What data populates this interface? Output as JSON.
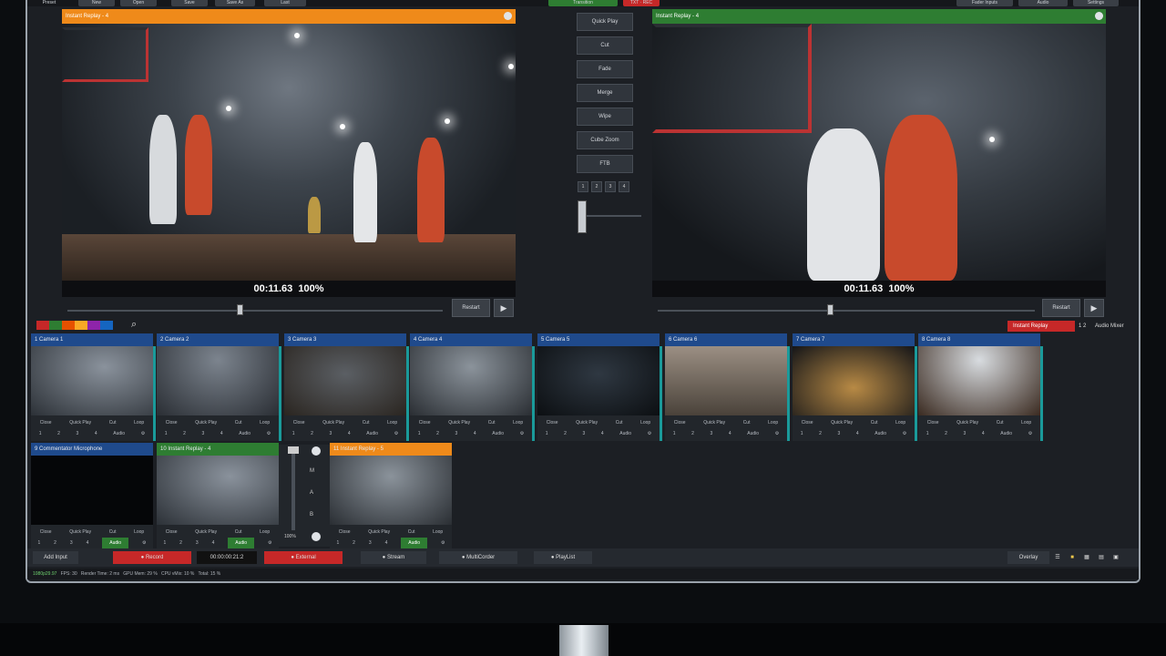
{
  "top_toolbar": {
    "items": [
      "Preset",
      "New",
      "Open",
      "Save",
      "Save As",
      "Last"
    ],
    "transition_dropdown": "Transition",
    "replay_status": "TXT · REC",
    "right_items": [
      "Fader Inputs",
      "Audio",
      "Settings"
    ]
  },
  "preview": {
    "title": "Instant Replay - 4",
    "timecode": "00:11.63",
    "zoom": "100%",
    "restart": "Restart"
  },
  "output": {
    "title": "Instant Replay - 4",
    "timecode": "00:11.63",
    "zoom": "100%",
    "restart": "Restart"
  },
  "transitions": {
    "buttons": [
      "Quick Play",
      "Cut",
      "Fade",
      "Merge",
      "Wipe",
      "Cube Zoom",
      "FTB"
    ],
    "numbers": [
      "1",
      "2",
      "3",
      "4"
    ]
  },
  "color_swatches": [
    "#c62828",
    "#2e7d32",
    "#e65100",
    "#f9a825",
    "#8e24aa",
    "#1565c0"
  ],
  "audio_mixer": {
    "instant_replay": "Instant Replay",
    "count": "1 2",
    "label": "Audio Mixer"
  },
  "tile_controls": {
    "row1": [
      "Close",
      "Quick Play",
      "Cut",
      "Loop"
    ],
    "row2": [
      "1",
      "2",
      "3",
      "4",
      "Audio"
    ]
  },
  "inputs": [
    {
      "label": "1   Camera 1",
      "color": "#1f4a8c"
    },
    {
      "label": "2   Camera 2",
      "color": "#1f4a8c"
    },
    {
      "label": "3   Camera 3",
      "color": "#1f4a8c"
    },
    {
      "label": "4   Camera 4",
      "color": "#1f4a8c"
    },
    {
      "label": "5   Camera 5",
      "color": "#1f4a8c"
    },
    {
      "label": "6   Camera 6",
      "color": "#1f4a8c"
    },
    {
      "label": "7   Camera 7",
      "color": "#1f4a8c"
    },
    {
      "label": "8   Camera 8",
      "color": "#1f4a8c"
    },
    {
      "label": "9   Commentator Microphone",
      "color": "#1f4a8c"
    },
    {
      "label": "10   Instant Replay - 4",
      "color": "#2e7d32"
    },
    {
      "label": "11   Instant Replay - 5",
      "color": "#ef8a1a"
    }
  ],
  "master": {
    "labels": [
      "100%",
      "M",
      "A",
      "B"
    ]
  },
  "bottom_bar": {
    "add_input": "Add Input",
    "record": "Record",
    "rec_time": "00:00:00:21:2",
    "external": "External",
    "stream": "Stream",
    "multicorder": "MultiCorder",
    "playlist": "PlayList",
    "overlay": "Overlay"
  },
  "status": {
    "resolution": "1080p29.97",
    "fps_label": "FPS:",
    "fps": "30",
    "render_label": "Render Time:",
    "render": "2 ms",
    "gpu_label": "GPU Mem:",
    "gpu": "29 %",
    "cpu_label": "CPU vMix:",
    "cpu": "10 %",
    "total_label": "Total:",
    "total": "15 %"
  },
  "colors": {
    "orange": "#ef8a1a",
    "green": "#2e7d32",
    "red": "#c62828",
    "blue": "#1f4a8c"
  }
}
